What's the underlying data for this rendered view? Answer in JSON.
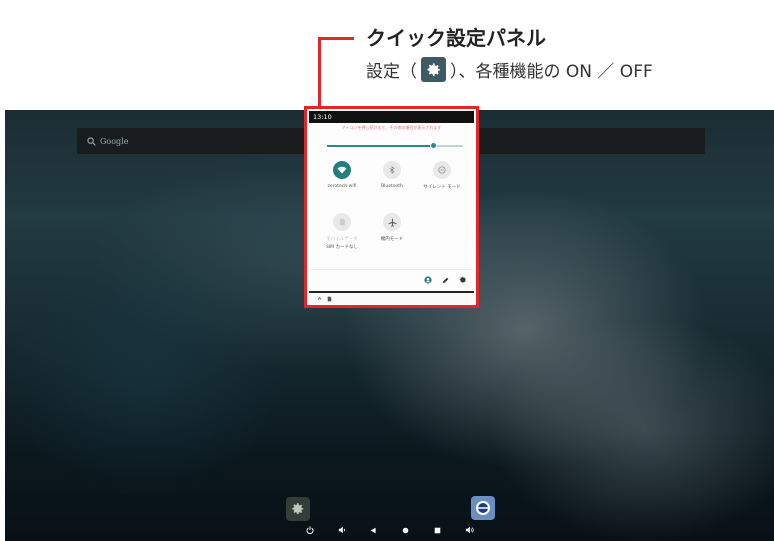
{
  "annotation": {
    "title": "クイック設定パネル",
    "desc_before": "設定（",
    "desc_after": "）、各種機能の ON ／ OFF",
    "gear_icon": "gear-icon",
    "accent_color": "#e2262a"
  },
  "desktop": {
    "search_placeholder": "Google",
    "app_icons": [
      "settings-app-icon",
      "browser-app-icon"
    ]
  },
  "quick_settings": {
    "time": "13:10",
    "hint": "アイコンを押し続けると、その他の項目が表示されます",
    "brightness": 0.78,
    "tiles": [
      {
        "label": "zerotech-wifi",
        "icon": "wifi-icon",
        "on": true
      },
      {
        "label": "Bluetooth",
        "icon": "bluetooth-icon",
        "on": false
      },
      {
        "label": "サイレント モード",
        "icon": "dnd-icon",
        "on": false
      },
      {
        "label": "モバイルデータ",
        "label2": "SIM カードなし",
        "icon": "sim-icon",
        "on": false
      },
      {
        "label": "機内モード",
        "icon": "airplane-icon",
        "on": false
      }
    ],
    "footer_icons": [
      "user-icon",
      "edit-icon",
      "settings-gear-icon"
    ],
    "notification_icons": [
      "chevron-icon",
      "sim-card-icon"
    ],
    "accent": "#237f7f"
  },
  "navbar": [
    "power-icon",
    "volume-down-icon",
    "back-icon",
    "home-icon",
    "recents-icon",
    "volume-up-icon"
  ]
}
